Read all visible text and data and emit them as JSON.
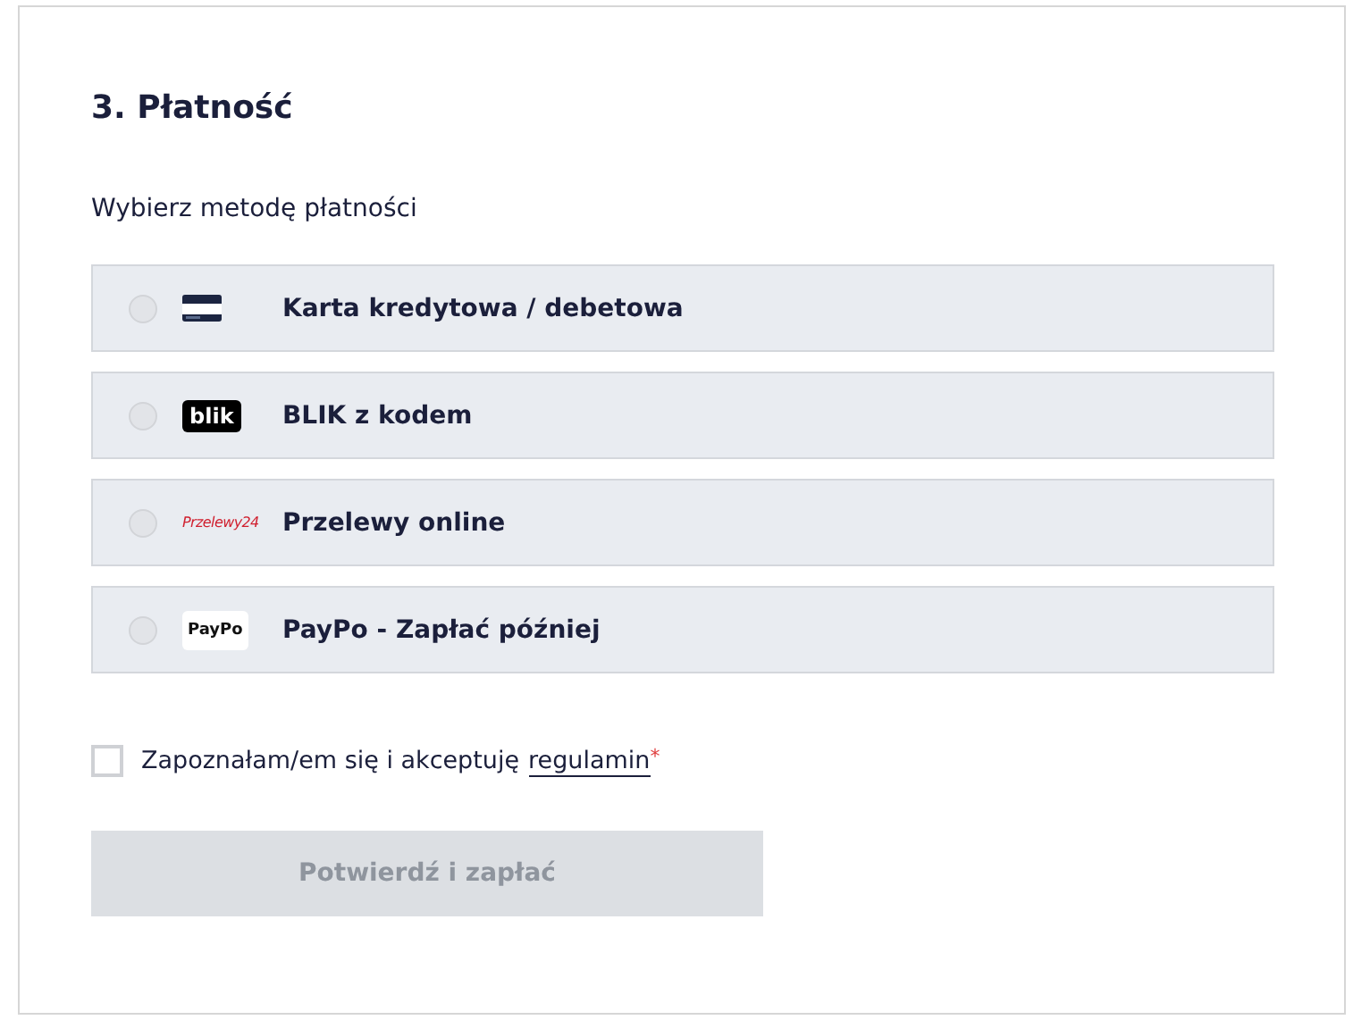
{
  "section_title": "3. Płatność",
  "prompt": "Wybierz metodę płatności",
  "methods": [
    {
      "kind": "card",
      "label": "Karta kredytowa / debetowa",
      "selected": false
    },
    {
      "kind": "blik",
      "logo": "blik",
      "label": "BLIK z kodem",
      "selected": false
    },
    {
      "kind": "p24",
      "logo": "Przelewy24",
      "label": "Przelewy online",
      "selected": false
    },
    {
      "kind": "paypo",
      "logo": "PayPo",
      "label": "PayPo - Zapłać później",
      "selected": false
    }
  ],
  "terms": {
    "checked": false,
    "text": "Zapoznałam/em się i akceptuję",
    "link": "regulamin",
    "required_mark": "*"
  },
  "submit": {
    "label": "Potwierdź i zapłać",
    "disabled": true
  }
}
